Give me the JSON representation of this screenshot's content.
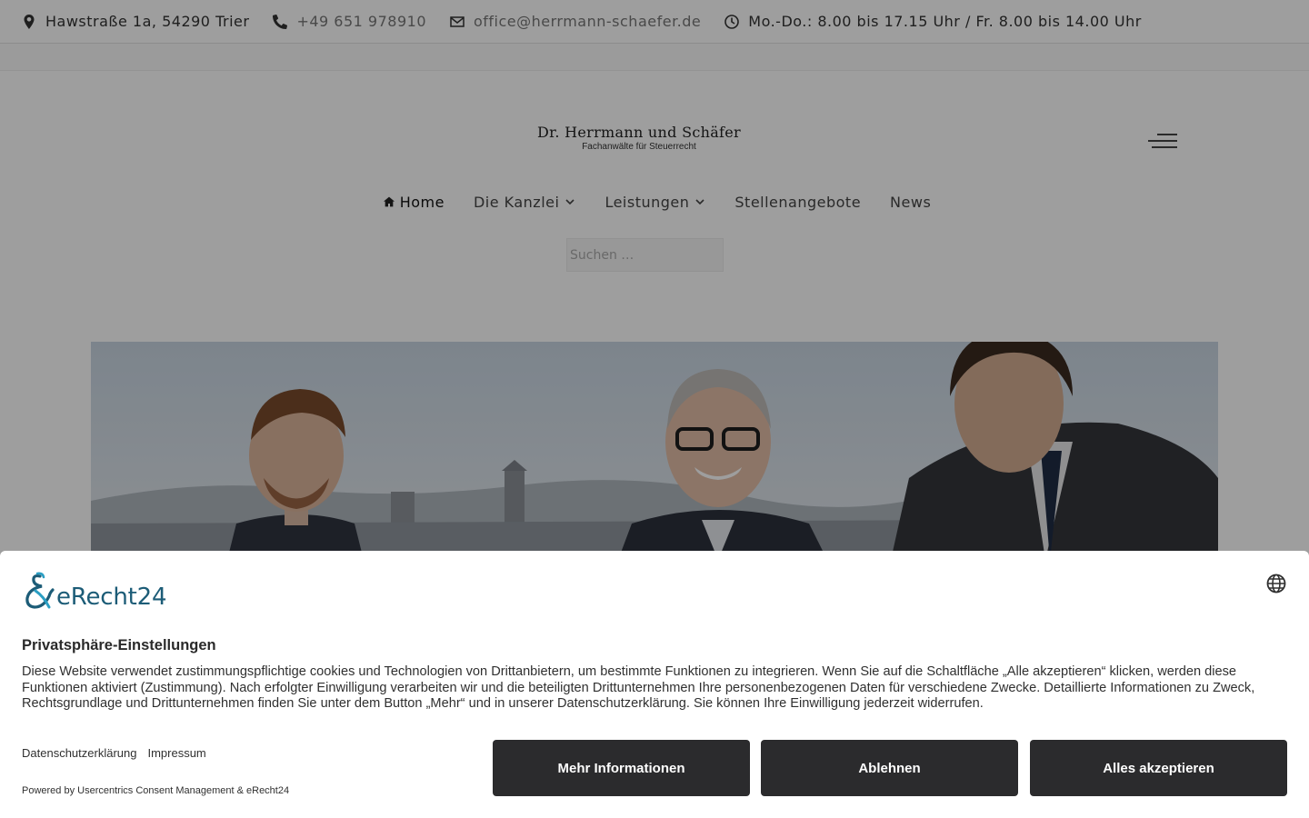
{
  "topbar": {
    "address": "Hawstraße 1a, 54290 Trier",
    "phone": "+49 651 978910",
    "email": "office@herrmann-schaefer.de",
    "hours": "Mo.-Do.: 8.00 bis 17.15 Uhr / Fr. 8.00 bis 14.00 Uhr",
    "icons": [
      "map-marker-icon",
      "phone-icon",
      "envelope-icon",
      "clock-icon"
    ]
  },
  "header": {
    "logo_name": "Dr. Herrmann und Schäfer",
    "logo_tagline": "Fachanwälte für Steuerrecht",
    "menu_icon": "hamburger-menu-icon"
  },
  "nav": {
    "items": [
      {
        "label": "Home",
        "active": true,
        "icon": "home-icon"
      },
      {
        "label": "Die Kanzlei",
        "dropdown": true
      },
      {
        "label": "Leistungen",
        "dropdown": true
      },
      {
        "label": "Stellenangebote"
      },
      {
        "label": "News"
      }
    ]
  },
  "search": {
    "placeholder": "Suchen …",
    "value": ""
  },
  "consent": {
    "brand": "eRecht24",
    "title": "Privatsphäre-Einstellungen",
    "text": "Diese Website verwendet zustimmungspflichtige cookies und Technologien von Drittanbietern, um bestimmte Funktionen zu integrieren. Wenn Sie auf die Schaltfläche „Alle akzeptieren“ klicken, werden diese Funktionen aktiviert (Zustimmung). Nach erfolgter Einwilligung verarbeiten wir und die beteiligten Drittunternehmen Ihre personenbezogenen Daten für verschiedene Zwecke. Detaillierte Informationen zu Zweck, Rechtsgrundlage und Drittunternehmen finden Sie unter dem Button „Mehr“ und in unserer Datenschutzerklärung. Sie können Ihre Einwilligung jederzeit widerrufen.",
    "link_privacy": "Datenschutzerklärung",
    "link_imprint": "Impressum",
    "powered": "Powered by Usercentrics Consent Management & eRecht24",
    "btn_more": "Mehr Informationen",
    "btn_deny": "Ablehnen",
    "btn_accept": "Alles akzeptieren",
    "language_icon": "globe-icon"
  },
  "colors": {
    "overlay": "rgba(0,0,0,0.38)",
    "button_bg": "#2b2b2d",
    "brand_teal": "#1c5c77"
  }
}
